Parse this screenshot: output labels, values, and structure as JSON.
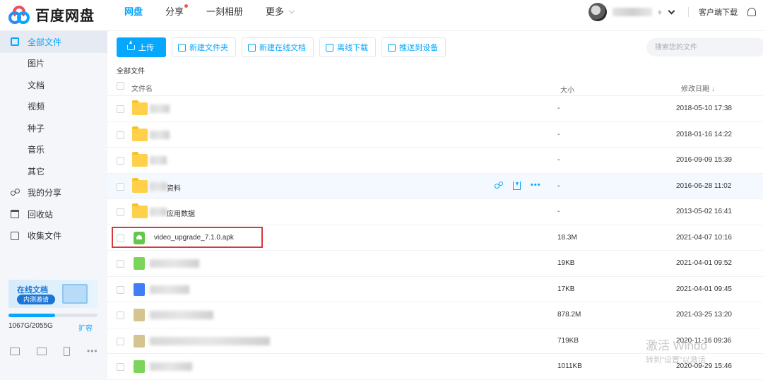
{
  "app": {
    "logo_text": "百度网盘"
  },
  "nav": [
    {
      "label": "网盘",
      "active": true
    },
    {
      "label": "分享",
      "dot": true
    },
    {
      "label": "一刻相册"
    },
    {
      "label": "更多",
      "caret": true
    }
  ],
  "header": {
    "client_download": "客户端下载"
  },
  "sidebar": {
    "items": [
      {
        "label": "全部文件",
        "active": true
      },
      {
        "label": "图片"
      },
      {
        "label": "文档"
      },
      {
        "label": "视频"
      },
      {
        "label": "种子"
      },
      {
        "label": "音乐"
      },
      {
        "label": "其它"
      },
      {
        "label": "我的分享"
      },
      {
        "label": "回收站"
      },
      {
        "label": "收集文件"
      }
    ],
    "promo": {
      "title": "在线文档",
      "button": "内测邀请"
    },
    "quota": {
      "text": "1067G/2055G",
      "expand": "扩容",
      "used_fraction": 0.52
    }
  },
  "toolbar": {
    "upload": "上传",
    "new_folder": "新建文件夹",
    "new_online_doc": "新建在线文档",
    "offline_download": "离线下载",
    "push_device": "推送到设备"
  },
  "search": {
    "placeholder": "搜索您的文件"
  },
  "breadcrumb": "全部文件",
  "table": {
    "headers": {
      "name": "文件名",
      "size": "大小",
      "date": "修改日期"
    },
    "rows": [
      {
        "name": "",
        "size": "-",
        "date": "2018-05-10 17:38",
        "icon": "folder"
      },
      {
        "name": "",
        "size": "-",
        "date": "2018-01-16 14:22",
        "icon": "folder"
      },
      {
        "name": "",
        "size": "-",
        "date": "2016-09-09 15:39",
        "icon": "folder"
      },
      {
        "name": "资料",
        "size": "-",
        "date": "2016-06-28 11:02",
        "icon": "folder",
        "hover": true
      },
      {
        "name": "应用数据",
        "size": "-",
        "date": "2013-05-02 16:41",
        "icon": "folder"
      },
      {
        "name": "video_upgrade_7.1.0.apk",
        "size": "18.3M",
        "date": "2021-04-07 10:16",
        "icon": "apk",
        "highlight": true
      },
      {
        "name": "",
        "size": "19KB",
        "date": "2021-04-01 09:52",
        "icon": "green"
      },
      {
        "name": "",
        "size": "17KB",
        "date": "2021-04-01 09:45",
        "icon": "blue"
      },
      {
        "name": "",
        "size": "878.2M",
        "date": "2021-03-25 13:20",
        "icon": "tan"
      },
      {
        "name": "",
        "size": "719KB",
        "date": "2020-11-16 09:36",
        "icon": "tan"
      },
      {
        "name": "",
        "size": "1011KB",
        "date": "2020-09-29 15:46",
        "icon": "green"
      }
    ]
  },
  "watermark": {
    "line1": "激活 Windo",
    "line2": "转到\"设置\"以激活"
  }
}
